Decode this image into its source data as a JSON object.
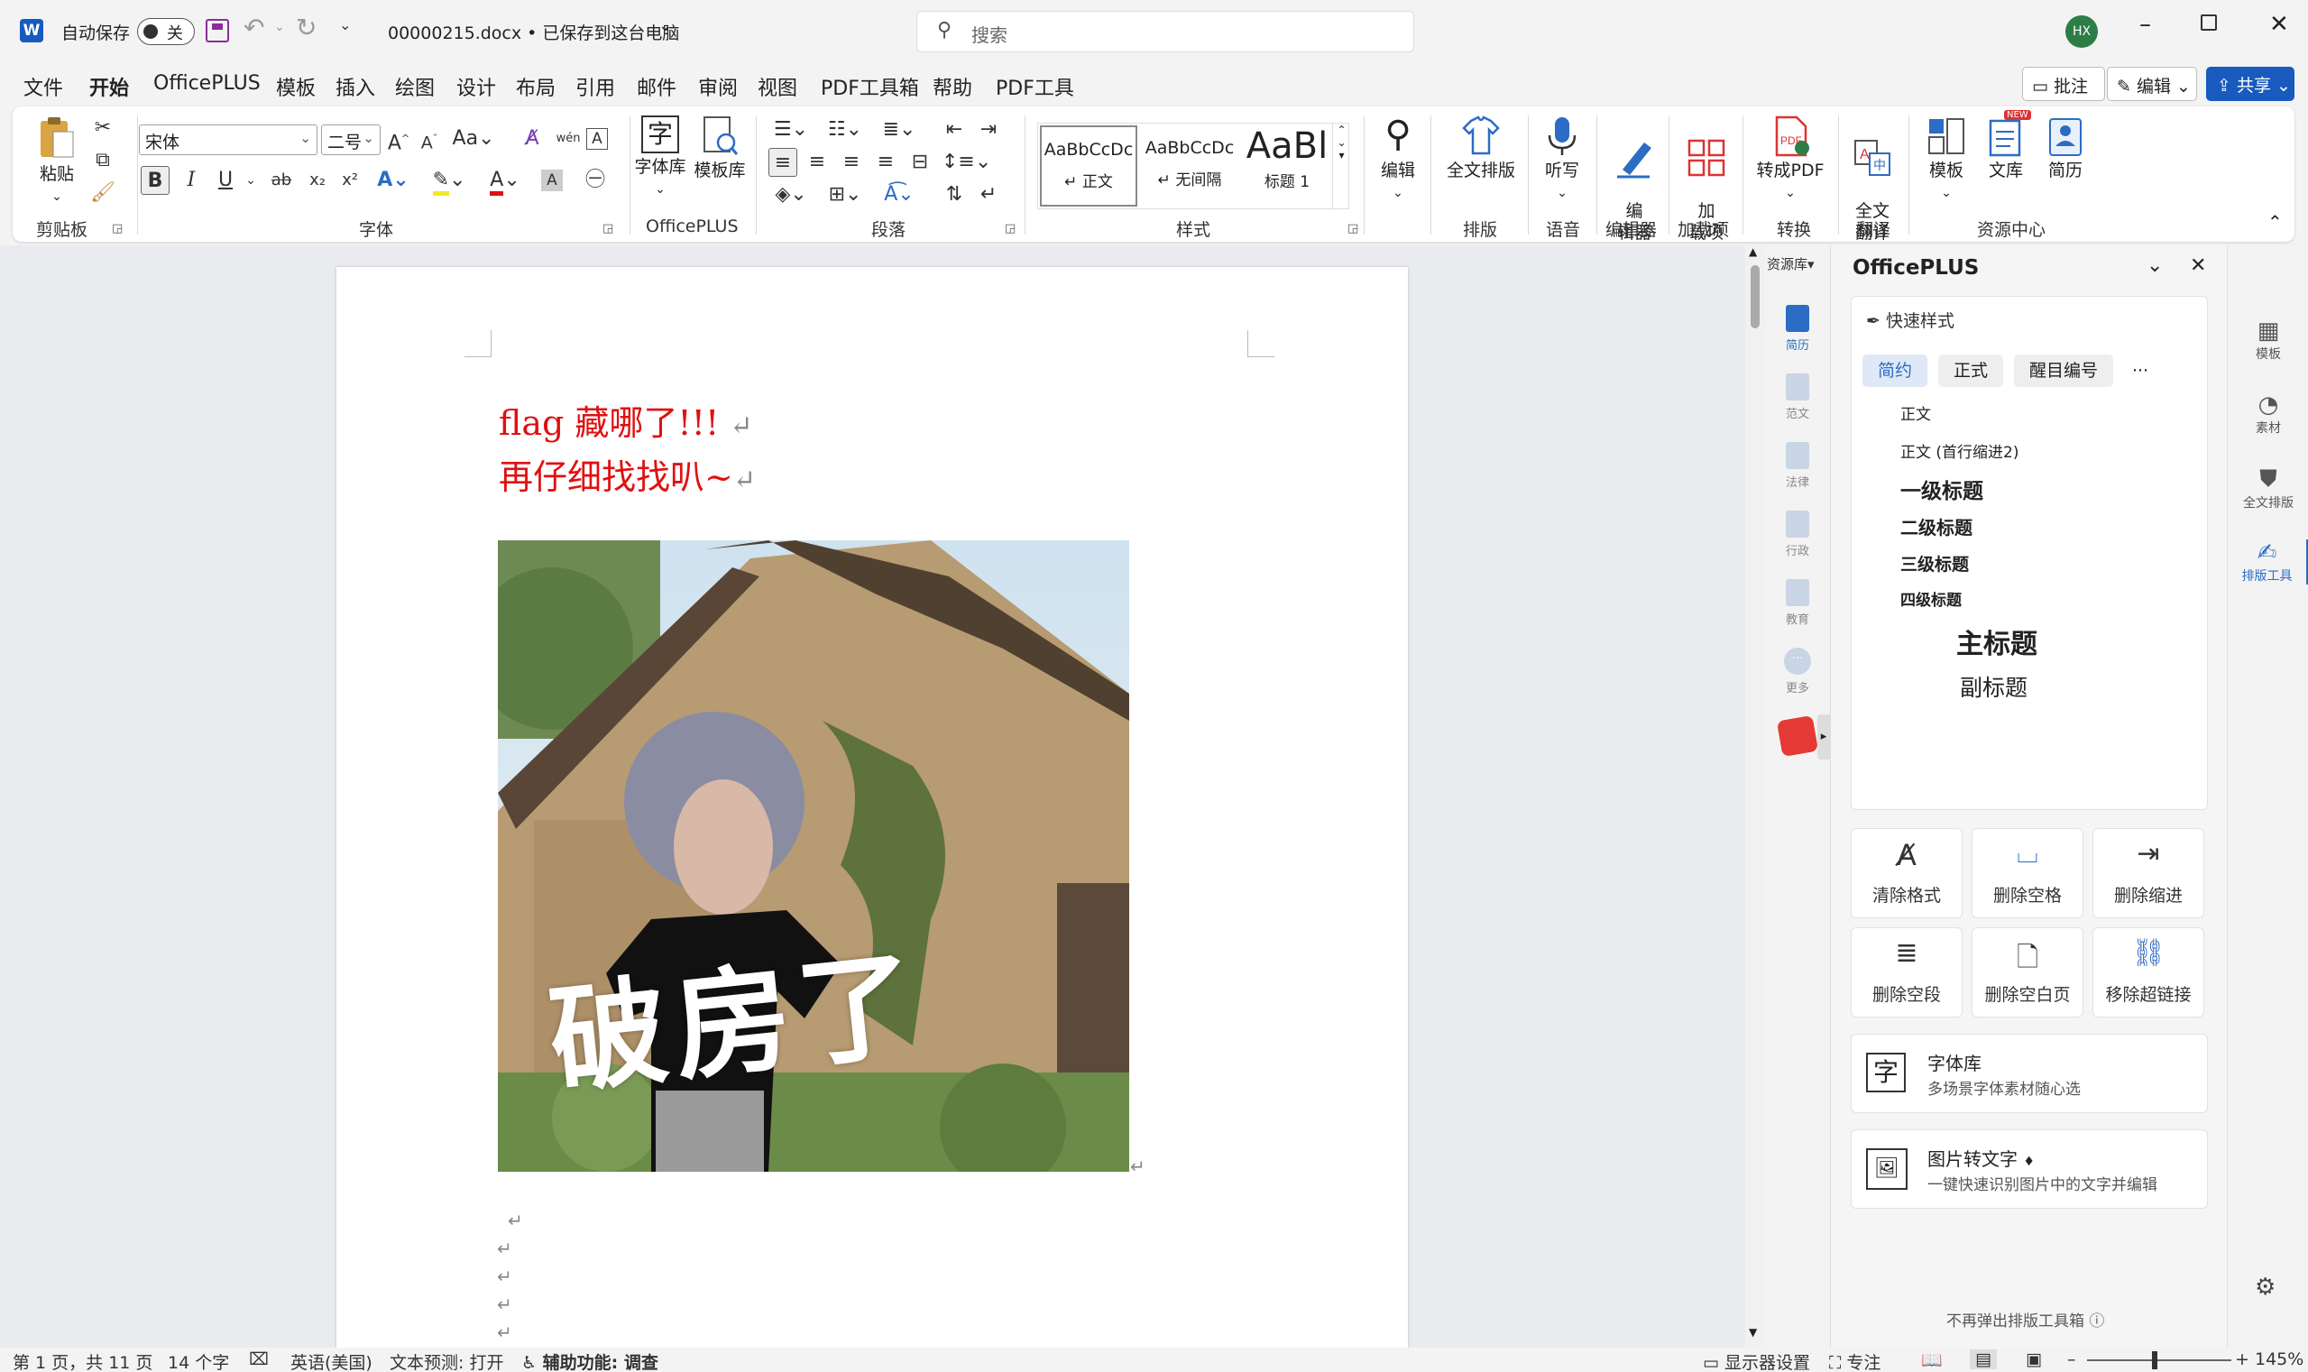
{
  "titlebar": {
    "autosave_label": "自动保存",
    "autosave_state": "关",
    "filename": "00000215.docx • 已保存到这台电脑",
    "search_placeholder": "搜索",
    "avatar": "HX"
  },
  "menu": {
    "items": [
      "文件",
      "开始",
      "OfficePLUS",
      "模板",
      "插入",
      "绘图",
      "设计",
      "布局",
      "引用",
      "邮件",
      "审阅",
      "视图",
      "PDF工具箱",
      "帮助",
      "PDF工具"
    ],
    "comment": "批注",
    "edit": "编辑",
    "share": "共享"
  },
  "ribbon": {
    "clipboard": {
      "paste": "粘贴",
      "label": "剪贴板"
    },
    "font": {
      "name": "宋体",
      "size": "二号",
      "label": "字体"
    },
    "officeplus": {
      "fontlib": "字体库",
      "templib": "模板库",
      "label": "OfficePLUS"
    },
    "paragraph": {
      "label": "段落"
    },
    "styles": {
      "items": [
        {
          "preview": "AaBbCcDc",
          "name": "↵ 正文"
        },
        {
          "preview": "AaBbCcDc",
          "name": "↵ 无间隔"
        },
        {
          "preview": "AaBl",
          "name": "标题 1"
        }
      ],
      "label": "样式"
    },
    "editing": {
      "label": "编辑"
    },
    "layout": {
      "btn": "全文排版",
      "label": "排版"
    },
    "voice": {
      "btn": "听写",
      "label": "语音"
    },
    "editor": {
      "btn": "编\n辑器",
      "label": "编辑器"
    },
    "addins": {
      "btn": "加\n载项",
      "label": "加载项"
    },
    "convert": {
      "btn": "转成PDF",
      "label": "转换"
    },
    "translate": {
      "btn": "全文\n翻译",
      "label": "翻译"
    },
    "resources": {
      "template": "模板",
      "library": "文库",
      "resume": "简历",
      "label": "资源中心",
      "new_badge": "NEW"
    }
  },
  "document": {
    "line1": "flag 藏哪了!!!",
    "line2": "再仔细找找叭~",
    "image_caption": "破房了",
    "pilcrow": "↵"
  },
  "sidestrip": {
    "header": "资源库",
    "items": [
      "简历",
      "范文",
      "法律",
      "行政",
      "教育",
      "更多"
    ]
  },
  "pane": {
    "title": "OfficePLUS",
    "quick_style": "快速样式",
    "tabs": [
      "简约",
      "正式",
      "醒目编号",
      "···"
    ],
    "styles": [
      "正文",
      "正文 (首行缩进2)",
      "一级标题",
      "二级标题",
      "三级标题",
      "四级标题",
      "主标题",
      "副标题"
    ],
    "tools": [
      "清除格式",
      "删除空格",
      "删除缩进",
      "删除空段",
      "删除空白页",
      "移除超链接"
    ],
    "fontlib": {
      "title": "字体库",
      "desc": "多场景字体素材随心选"
    },
    "ocr": {
      "title": "图片转文字",
      "desc": "一键快速识别图片中的文字并编辑"
    },
    "footer": "不再弹出排版工具箱"
  },
  "rightstrip": {
    "items": [
      "模板",
      "素材",
      "全文排版",
      "排版工具"
    ]
  },
  "status": {
    "page": "第 1 页，共 11 页",
    "words": "14 个字",
    "lang": "英语(美国)",
    "predict": "文本预测: 打开",
    "access": "辅助功能: 调查",
    "display": "显示器设置",
    "focus": "专注",
    "zoom": "145%"
  },
  "colors": {
    "accent": "#185abd",
    "red_text": "#e01010",
    "share_btn": "#185abd"
  }
}
